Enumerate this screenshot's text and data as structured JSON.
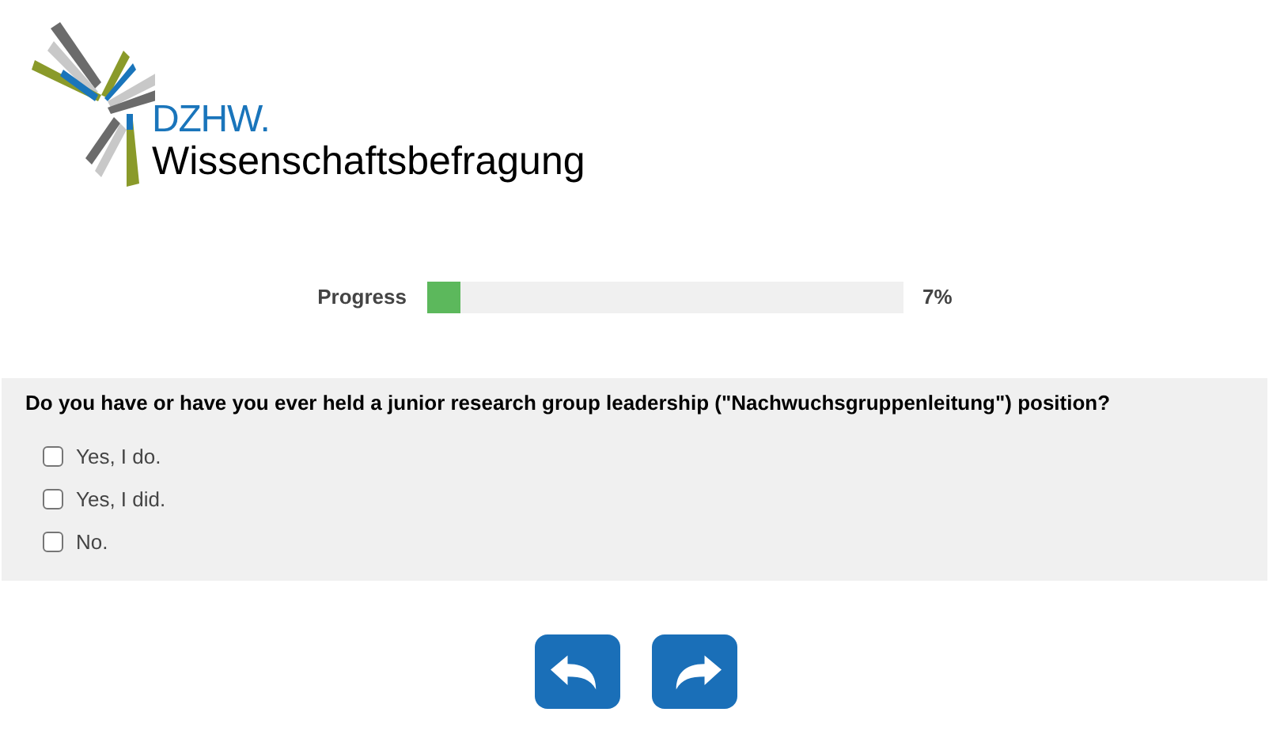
{
  "logo": {
    "brand": "DZHW.",
    "name": "Wissenschaftsbefragung"
  },
  "progress": {
    "label": "Progress",
    "level": 0.07,
    "reading": "7%"
  },
  "question": {
    "text": "Do you have or have you ever held a junior research group leadership (\"Nachwuchsgruppenleitung\") position?",
    "options": [
      {
        "label": "Yes, I do.",
        "checked": false
      },
      {
        "label": "Yes, I did.",
        "checked": false
      },
      {
        "label": "No.",
        "checked": false
      }
    ]
  },
  "navigation": [
    {
      "kind": "back"
    },
    {
      "kind": "forward"
    }
  ]
}
